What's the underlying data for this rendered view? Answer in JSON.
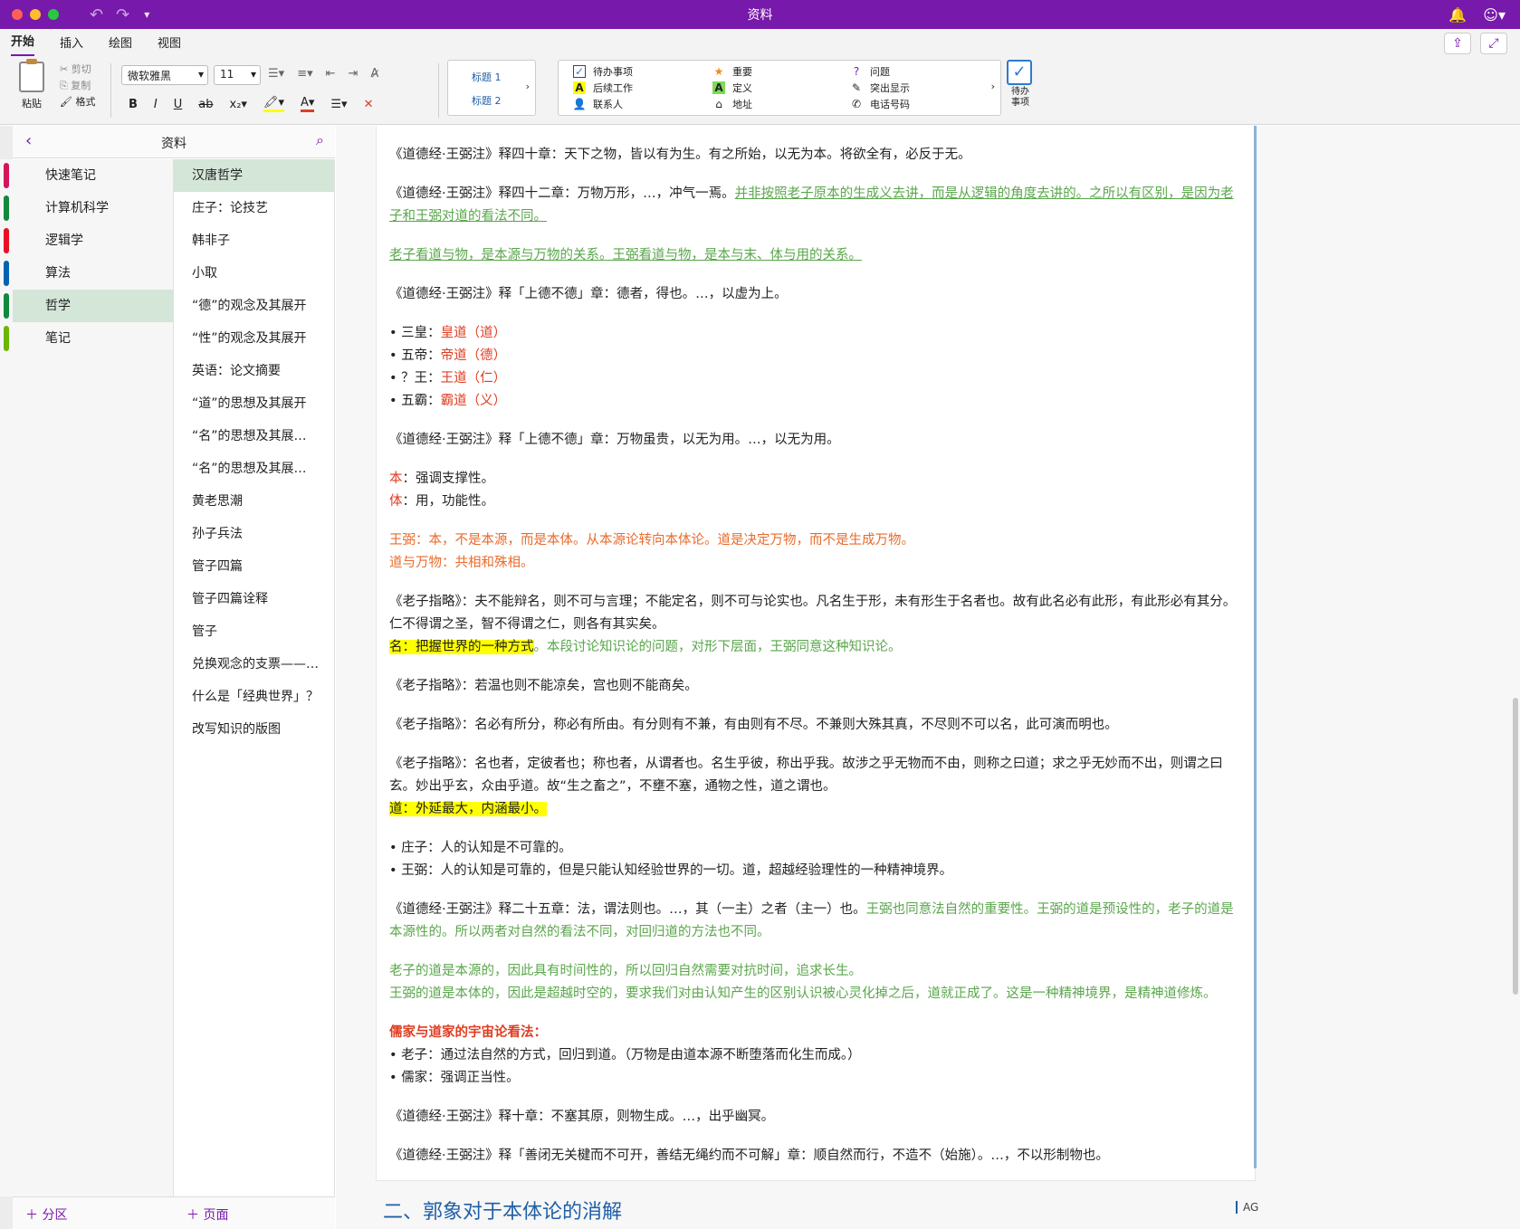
{
  "app": {
    "title": "资料"
  },
  "menu": {
    "tabs": [
      "开始",
      "插入",
      "绘图",
      "视图"
    ]
  },
  "ribbon": {
    "paste": "粘贴",
    "cut": "剪切",
    "copy": "复制",
    "format": "格式",
    "font_name": "微软雅黑",
    "font_size": "11",
    "style1": "标题 1",
    "style2": "标题 2",
    "tags": {
      "todo": "待办事项",
      "important": "重要",
      "question": "问题",
      "later": "后续工作",
      "define": "定义",
      "highlight": "突出显示",
      "contact": "联系人",
      "address": "地址",
      "phone": "电话号码"
    },
    "todo_button": "待办\n事项"
  },
  "notebook": {
    "title": "资料",
    "sections": [
      {
        "label": "快速笔记",
        "color": "#d4145a"
      },
      {
        "label": "计算机科学",
        "color": "#10893e"
      },
      {
        "label": "逻辑学",
        "color": "#e81123"
      },
      {
        "label": "算法",
        "color": "#0063b1"
      },
      {
        "label": "哲学",
        "color": "#10893e"
      },
      {
        "label": "笔记",
        "color": "#6bb700"
      }
    ],
    "selected_section": 4,
    "pages": [
      "汉唐哲学",
      "庄子：论技艺",
      "韩非子",
      "小取",
      "“德”的观念及其展开",
      "“性”的观念及其展开",
      "英语：论文摘要",
      "“道”的思想及其展开",
      "“名”的思想及其展…",
      "“名”的思想及其展…",
      "黄老思潮",
      "孙子兵法",
      "管子四篇",
      "管子四篇诠释",
      "管子",
      "兑换观念的支票——…",
      "什么是「经典世界」？",
      "改写知识的版图"
    ],
    "add_section": "分区",
    "add_page": "页面"
  },
  "content": {
    "l1": "《道德经·王弼注》释四十章：天下之物，皆以有为生。有之所始，以无为本。将欲全有，必反于无。",
    "l2a": "《道德经·王弼注》释四十二章：万物万形，…，冲气一焉。",
    "l2b": "并非按照老子原本的生成义去讲，而是从逻辑的角度去讲的。之所以有区别，是因为老子和王弼对道的看法不同。",
    "l3": "老子看道与物，是本源与万物的关系。王弼看道与物，是本与末、体与用的关系。",
    "l4": "《道德经·王弼注》释「上德不德」章：德者，得也。…，以虚为上。",
    "bullets1": [
      {
        "a": "三皇：",
        "b": "皇道（道）"
      },
      {
        "a": "五帝：",
        "b": "帝道（德）"
      },
      {
        "a": "？王：",
        "b": "王道（仁）"
      },
      {
        "a": "五霸：",
        "b": "霸道（义）"
      }
    ],
    "l5": "《道德经·王弼注》释「上德不德」章：万物虽贵，以无为用。…，以无为用。",
    "l6a": "本",
    "l6b": "：强调支撑性。",
    "l7a": "体",
    "l7b": "：用，功能性。",
    "l8": "王弼：本，不是本源，而是本体。从本源论转向本体论。道是决定万物，而不是生成万物。",
    "l9": "道与万物：共相和殊相。",
    "l10": "《老子指略》：夫不能辩名，则不可与言理；不能定名，则不可与论实也。凡名生于形，未有形生于名者也。故有此名必有此形，有此形必有其分。仁不得谓之圣，智不得谓之仁，则各有其实矣。",
    "l11a": "名：把握世界的一种方式",
    "l11b": "。本段讨论知识论的问题，对形下层面，王弼同意这种知识论。",
    "l12": "《老子指略》：若温也则不能凉矣，宫也则不能商矣。",
    "l13": "《老子指略》：名必有所分，称必有所由。有分则有不兼，有由则有不尽。不兼则大殊其真，不尽则不可以名，此可演而明也。",
    "l14": "《老子指略》：名也者，定彼者也；称也者，从谓者也。名生乎彼，称出乎我。故涉之乎无物而不由，则称之曰道；求之乎无妙而不出，则谓之曰玄。妙出乎玄，众由乎道。故“生之畜之”，不壅不塞，通物之性，道之谓也。",
    "l15": "道：外延最大，内涵最小。",
    "bullets2": [
      "庄子：人的认知是不可靠的。",
      "王弼：人的认知是可靠的，但是只能认知经验世界的一切。道，超越经验理性的一种精神境界。"
    ],
    "l16a": "《道德经·王弼注》释二十五章：法，谓法则也。…，其（一主）之者（主一）也。",
    "l16b": "王弼也同意法自然的重要性。王弼的道是预设性的，老子的道是本源性的。所以两者对自然的看法不同，对回归道的方法也不同。",
    "l17": "老子的道是本源的，因此具有时间性的，所以回归自然需要对抗时间，追求长生。",
    "l18": "王弼的道是本体的，因此是超越时空的，要求我们对由认知产生的区别认识被心灵化掉之后，道就正成了。这是一种精神境界，是精神道修炼。",
    "l19": "儒家与道家的宇宙论看法：",
    "bullets3": [
      "老子：通过法自然的方式，回归到道。（万物是由道本源不断堕落而化生而成。）",
      "儒家：强调正当性。"
    ],
    "l20": "《道德经·王弼注》释十章：不塞其原，则物生成。…，出乎幽冥。",
    "l21": "《道德经·王弼注》释「善闭无关楗而不可开，善结无绳约而不可解」章：顺自然而行，不造不（始施）。…，不以形制物也。",
    "heading": "二、郭象对于本体论的消解",
    "ag": "AG"
  }
}
